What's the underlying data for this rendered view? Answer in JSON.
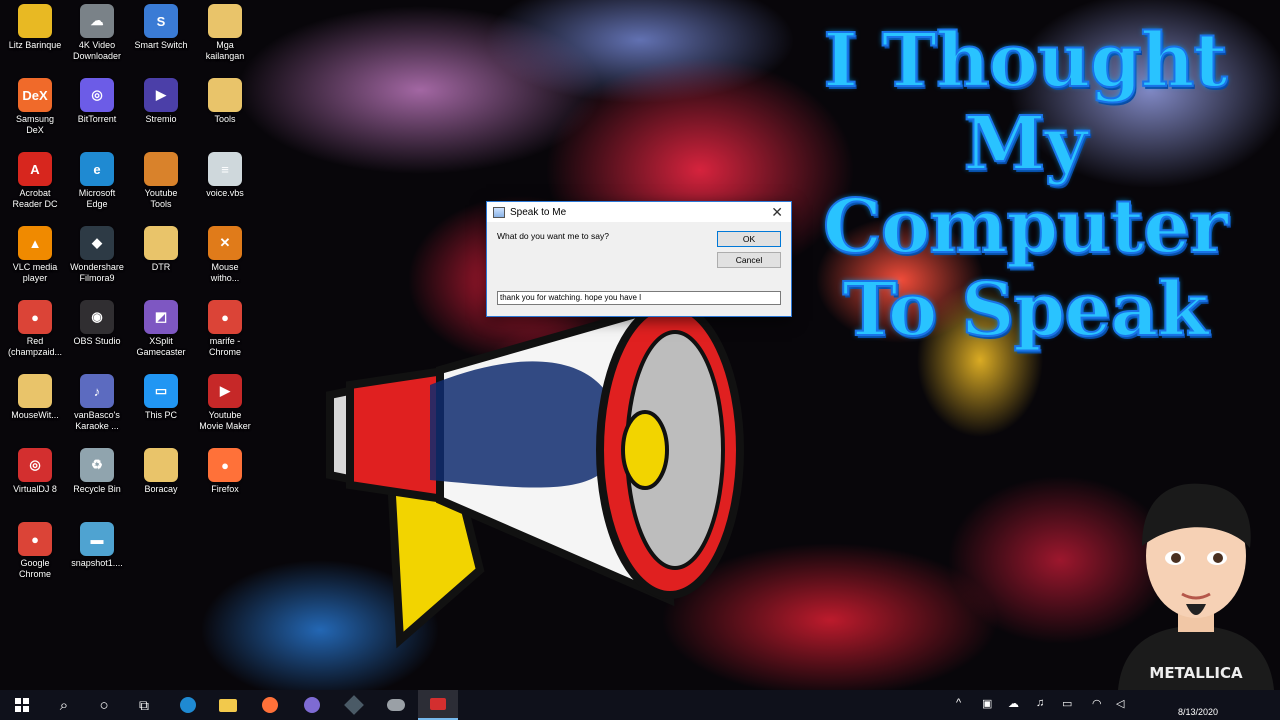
{
  "desktop_icons": [
    {
      "label": "Litz Barinque",
      "glyph": "",
      "color": "#e8b923",
      "icon": "user-folder-icon"
    },
    {
      "label": "4K Video\nDownloader",
      "glyph": "☁",
      "color": "#7a8288",
      "icon": "cloud-download-icon"
    },
    {
      "label": "Smart Switch",
      "glyph": "S",
      "color": "#3a7bd5",
      "icon": "smart-switch-icon"
    },
    {
      "label": "Mga\nkailangan",
      "glyph": "",
      "color": "#e9c46a",
      "icon": "folder-icon"
    },
    {
      "label": "Samsung\nDeX",
      "glyph": "DeX",
      "color": "#f06a2a",
      "icon": "samsung-dex-icon"
    },
    {
      "label": "BitTorrent",
      "glyph": "◎",
      "color": "#6c5ce7",
      "icon": "bittorrent-icon"
    },
    {
      "label": "Stremio",
      "glyph": "▶",
      "color": "#4b3fa8",
      "icon": "stremio-icon"
    },
    {
      "label": "Tools",
      "glyph": "",
      "color": "#e9c46a",
      "icon": "folder-icon"
    },
    {
      "label": "Acrobat\nReader DC",
      "glyph": "A",
      "color": "#d7261e",
      "icon": "acrobat-icon"
    },
    {
      "label": "Microsoft\nEdge",
      "glyph": "e",
      "color": "#1f8ad2",
      "icon": "edge-icon"
    },
    {
      "label": "Youtube\nTools",
      "glyph": "",
      "color": "#d9822b",
      "icon": "folder-icon"
    },
    {
      "label": "voice.vbs",
      "glyph": "≡",
      "color": "#cfd8dc",
      "icon": "script-file-icon"
    },
    {
      "label": "VLC media\nplayer",
      "glyph": "▲",
      "color": "#f08a00",
      "icon": "vlc-icon"
    },
    {
      "label": "Wondershare\nFilmora9",
      "glyph": "◆",
      "color": "#2d3a45",
      "icon": "filmora-icon"
    },
    {
      "label": "DTR",
      "glyph": "",
      "color": "#e9c46a",
      "icon": "folder-icon"
    },
    {
      "label": "Mouse\nwitho...",
      "glyph": "✕",
      "color": "#e07b1a",
      "icon": "mouse-without-borders-icon"
    },
    {
      "label": "Red\n(champzaid...",
      "glyph": "●",
      "color": "#db4437",
      "icon": "chrome-icon"
    },
    {
      "label": "OBS Studio",
      "glyph": "◉",
      "color": "#302e31",
      "icon": "obs-icon"
    },
    {
      "label": "XSplit\nGamecaster",
      "glyph": "◩",
      "color": "#7e57c2",
      "icon": "xsplit-icon"
    },
    {
      "label": "marife -\nChrome",
      "glyph": "●",
      "color": "#db4437",
      "icon": "chrome-icon"
    },
    {
      "label": "MouseWit...",
      "glyph": "",
      "color": "#e9c46a",
      "icon": "folder-icon"
    },
    {
      "label": "vanBasco's\nKaraoke ...",
      "glyph": "♪",
      "color": "#5c6bc0",
      "icon": "karaoke-icon"
    },
    {
      "label": "This PC",
      "glyph": "▭",
      "color": "#2196f3",
      "icon": "computer-icon"
    },
    {
      "label": "Youtube\nMovie Maker",
      "glyph": "▶",
      "color": "#c62828",
      "icon": "movie-maker-icon"
    },
    {
      "label": "VirtualDJ 8",
      "glyph": "◎",
      "color": "#d32f2f",
      "icon": "virtualdj-icon"
    },
    {
      "label": "Recycle Bin",
      "glyph": "♻",
      "color": "#90a4ae",
      "icon": "recycle-bin-icon"
    },
    {
      "label": "Boracay",
      "glyph": "",
      "color": "#e9c46a",
      "icon": "folder-icon"
    },
    {
      "label": "Firefox",
      "glyph": "●",
      "color": "#ff7139",
      "icon": "firefox-icon"
    },
    {
      "label": "Google\nChrome",
      "glyph": "●",
      "color": "#db4437",
      "icon": "chrome-icon"
    },
    {
      "label": "snapshot1....",
      "glyph": "▬",
      "color": "#4fa3d1",
      "icon": "image-file-icon"
    }
  ],
  "headline": {
    "line1": "I Thought",
    "line2": "My",
    "line3": "Computer",
    "line4": "To Speak"
  },
  "dialog": {
    "title": "Speak to Me",
    "close": "✕",
    "prompt": "What do you want me to say?",
    "ok": "OK",
    "cancel": "Cancel",
    "input_value": "thank you for watching. hope you have l"
  },
  "avatar": {
    "shirt_text": "METALLICA"
  },
  "taskbar": {
    "start": "⊞",
    "search": "⌕",
    "cortana": "○",
    "taskview": "⧉",
    "apps": [
      "edge",
      "file-explorer",
      "firefox",
      "bittorrent",
      "filmora",
      "4k-downloader",
      "recorder"
    ],
    "tray": {
      "chevron": "^",
      "date": "8/13/2020"
    }
  },
  "colors": {
    "headline": "#29c3ff",
    "taskbar": "#10121c",
    "dialog_border": "#2b78d6"
  }
}
